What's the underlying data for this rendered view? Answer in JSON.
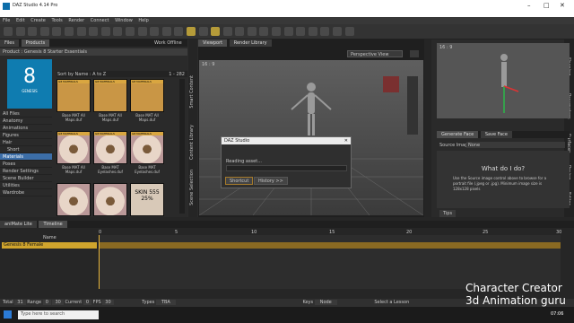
{
  "window": {
    "title": "DAZ Studio 4.14 Pro"
  },
  "menu": [
    "File",
    "Edit",
    "Create",
    "Tools",
    "Render",
    "Connect",
    "Window",
    "Help"
  ],
  "left_panel": {
    "tabs": [
      "Files",
      "Products"
    ],
    "works_offline": "Work Offline",
    "product_title": "Product : Genesis 8 Starter Essentials",
    "product_thumb": {
      "number": "8",
      "caption": "GENESIS"
    },
    "sort_label": "Sort by Name : A to Z",
    "count": "1 - 282",
    "categories": [
      "All Files",
      "Anatomy",
      "Animations",
      "Figures",
      "Hair",
      "Short",
      "Materials",
      "Poses",
      "Render Settings",
      "Scene Builder",
      "Utilities",
      "Wardrobe"
    ],
    "selected_category": "Materials",
    "tiles": [
      {
        "badge": "G8 MATERIALS",
        "label": "Base MAT All Maps.duf",
        "style": "skin"
      },
      {
        "badge": "G8 MATERIALS",
        "label": "Base MAT All Maps.duf",
        "style": "skin"
      },
      {
        "badge": "G8 MATERIALS",
        "label": "Base MAT All Maps.duf",
        "style": "skin"
      },
      {
        "badge": "G8 MATERIALS",
        "label": "Base MAT All Maps.duf",
        "style": "eye"
      },
      {
        "badge": "G8 MATERIALS",
        "label": "Base MAT Eyelashes.duf",
        "style": "eye"
      },
      {
        "badge": "G8 MATERIALS",
        "label": "Base MAT Eyelashes.duf",
        "style": "eye"
      },
      {
        "badge": "",
        "label": "",
        "style": "eye"
      },
      {
        "badge": "",
        "label": "",
        "style": "eye"
      },
      {
        "badge": "",
        "label": "SKIN 555 25%",
        "style": "tex"
      }
    ]
  },
  "side_tabs_left": [
    "Smart Content",
    "Content Library",
    "Scene Selection"
  ],
  "viewport": {
    "tabs": [
      "Viewport",
      "Render Library"
    ],
    "camera": "Perspective View",
    "ratio": "16 : 9"
  },
  "dialog": {
    "title": "DAZ Studio",
    "message": "Reading asset...",
    "buttons": [
      "Shortcut",
      "History >>"
    ]
  },
  "right_panel": {
    "ratio": "16 : 9",
    "tabs": [
      "Generate Face",
      "Save Face"
    ],
    "source_label": "Source Image:",
    "source_value": "None",
    "help_title": "What do I do?",
    "help_text": "Use the Source image control above to browse for a portrait file (.jpeg or .jpg). Minimum image size is 128x128 pixels",
    "tips": "Tips",
    "side_tabs": [
      "Shaping",
      "Parameters",
      "Surfaces",
      "Posing",
      "Editor"
    ]
  },
  "timeline": {
    "tabs": [
      "aniMate Lite",
      "Timeline"
    ],
    "name_col": "Name",
    "row": "Genesis 8 Female",
    "ticks": [
      "0",
      "5",
      "10",
      "15",
      "20",
      "25",
      "30"
    ],
    "bottom": {
      "total_label": "Total",
      "total": "31",
      "range_label": "Range",
      "range_start": "0",
      "range_end": "30",
      "current_label": "Current",
      "current": "0",
      "fps_label": "FPS",
      "fps": "30",
      "types_label": "Types",
      "types": "TBA",
      "keys_label": "Keys",
      "keys": "Node"
    }
  },
  "status": {
    "hint": "Select a Lesson"
  },
  "taskbar": {
    "search": "Type here to search",
    "time": "07:06"
  },
  "watermark": {
    "line1": "Character Creator",
    "line2": "3d Animation guru"
  },
  "colors": {
    "accent": "#c9a84a",
    "selection": "#3c6ea8",
    "product_blue": "#0f7cb0"
  }
}
